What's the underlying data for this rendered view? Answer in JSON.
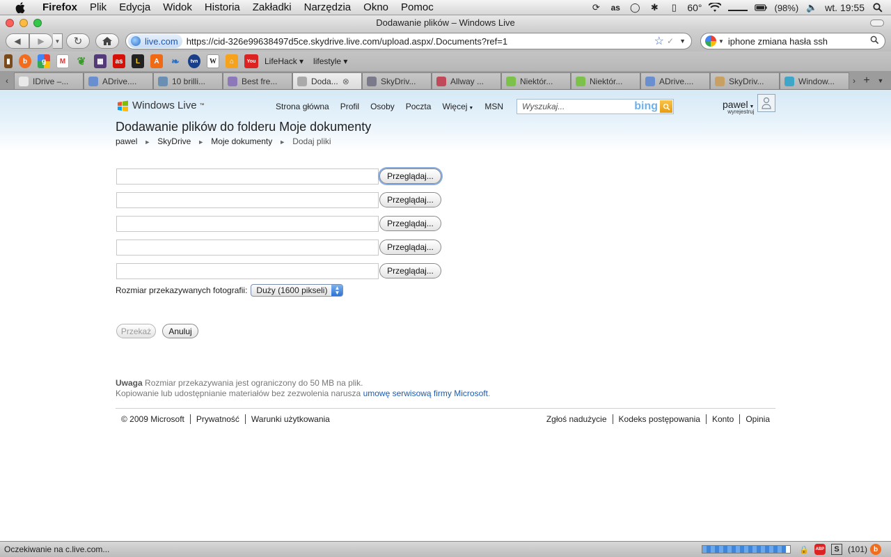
{
  "menubar": {
    "app": "Firefox",
    "items": [
      "Plik",
      "Edycja",
      "Widok",
      "Historia",
      "Zakładki",
      "Narzędzia",
      "Okno",
      "Pomoc"
    ],
    "temperature": "60°",
    "battery": "(98%)",
    "clock": "wt. 19:55"
  },
  "window": {
    "title": "Dodawanie plików – Windows Live"
  },
  "navbar": {
    "site_identity": "live.com",
    "url": "https://cid-326e99638497d5ce.skydrive.live.com/upload.aspx/.Documents?ref=1",
    "search_value": "iphone zmiana hasła ssh"
  },
  "bookmarks": {
    "folders": [
      "LifeHack",
      "lifestyle"
    ]
  },
  "tabs": [
    {
      "label": "IDrive –...",
      "active": false,
      "color": "#e9e9e9"
    },
    {
      "label": "ADrive....",
      "active": false,
      "color": "#6a8fd1"
    },
    {
      "label": "10 brilli...",
      "active": false,
      "color": "#6b8fb3"
    },
    {
      "label": "Best fre...",
      "active": false,
      "color": "#8d79b9"
    },
    {
      "label": "Doda...",
      "active": true,
      "color": "#aaaaaa"
    },
    {
      "label": "SkyDriv...",
      "active": false,
      "color": "#7a7a8a"
    },
    {
      "label": "Allway ...",
      "active": false,
      "color": "#c14a5a"
    },
    {
      "label": "Niektór...",
      "active": false,
      "color": "#7cc24a"
    },
    {
      "label": "Niektór...",
      "active": false,
      "color": "#7cc24a"
    },
    {
      "label": "ADrive....",
      "active": false,
      "color": "#6a8fd1"
    },
    {
      "label": "SkyDriv...",
      "active": false,
      "color": "#c8a063"
    },
    {
      "label": "Window...",
      "active": false,
      "color": "#3ea6c8"
    }
  ],
  "header": {
    "logo": "Windows Live",
    "logo_tm": "™",
    "nav": [
      "Strona główna",
      "Profil",
      "Osoby",
      "Poczta",
      "Więcej",
      "MSN"
    ],
    "search_placeholder": "Wyszukaj...",
    "search_brand": "bing",
    "user_name": "pawel",
    "user_signout": "wyrejestruj"
  },
  "page": {
    "title": "Dodawanie plików do folderu Moje dokumenty",
    "breadcrumb": [
      "pawel",
      "SkyDrive",
      "Moje dokumenty",
      "Dodaj pliki"
    ],
    "browse_label": "Przeglądaj...",
    "size_label": "Rozmiar przekazywanych fotografii:",
    "size_value": "Duży (1600 pikseli)",
    "upload_button": "Przekaż",
    "cancel_button": "Anuluj",
    "note_bold": "Uwaga",
    "note_text": " Rozmiar przekazywania jest ograniczony do 50 MB na plik.",
    "note_line2": "Kopiowanie lub udostępnianie materiałów bez zezwolenia narusza ",
    "note_link": "umowę serwisową firmy Microsoft",
    "note_end": "."
  },
  "footer": {
    "left": [
      "© 2009 Microsoft",
      "Prywatność",
      "Warunki użytkowania"
    ],
    "right": [
      "Zgłoś nadużycie",
      "Kodeks postępowania",
      "Konto",
      "Opinia"
    ]
  },
  "status": {
    "text": "Oczekiwanie na c.live.com...",
    "progress": 0.95,
    "count": "(101)"
  },
  "colors": {
    "link": "#1a5bb0",
    "hero_top": "#d6e9f6",
    "focus_ring": "#87aee2"
  }
}
